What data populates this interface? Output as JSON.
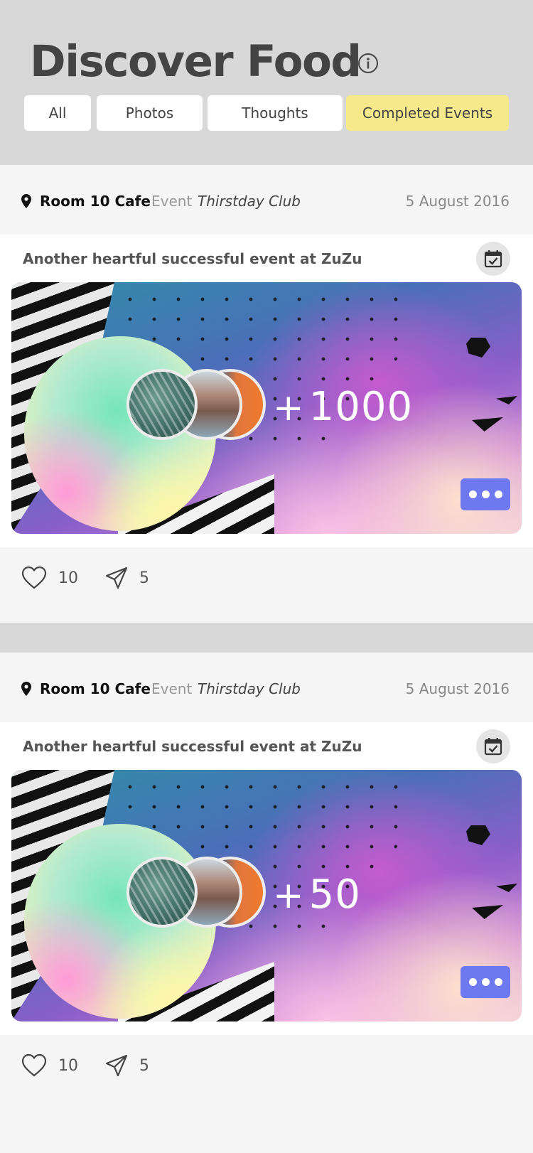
{
  "header": {
    "title": "Discover Food",
    "info_icon": "info-icon",
    "tabs": [
      {
        "label": "All"
      },
      {
        "label": "Photos"
      },
      {
        "label": "Thoughts"
      },
      {
        "label": "Completed Events",
        "active": true
      }
    ]
  },
  "colors": {
    "header_bg": "#d8d8d8",
    "active_tab": "#f5e98c",
    "more_button": "#6e78f0"
  },
  "posts": [
    {
      "venue": "Room 10 Cafe",
      "event_label": "Event",
      "event_name": "Thirstday Club",
      "date": "5 August 2016",
      "caption": "Another heartful successful event at ZuZu",
      "attendee_plus": "+",
      "attendee_count": "1000",
      "likes": "10",
      "shares": "5"
    },
    {
      "venue": "Room 10 Cafe",
      "event_label": "Event",
      "event_name": "Thirstday Club",
      "date": "5 August 2016",
      "caption": "Another heartful successful event at ZuZu",
      "attendee_plus": "+",
      "attendee_count": "50",
      "likes": "10",
      "shares": "5"
    }
  ]
}
